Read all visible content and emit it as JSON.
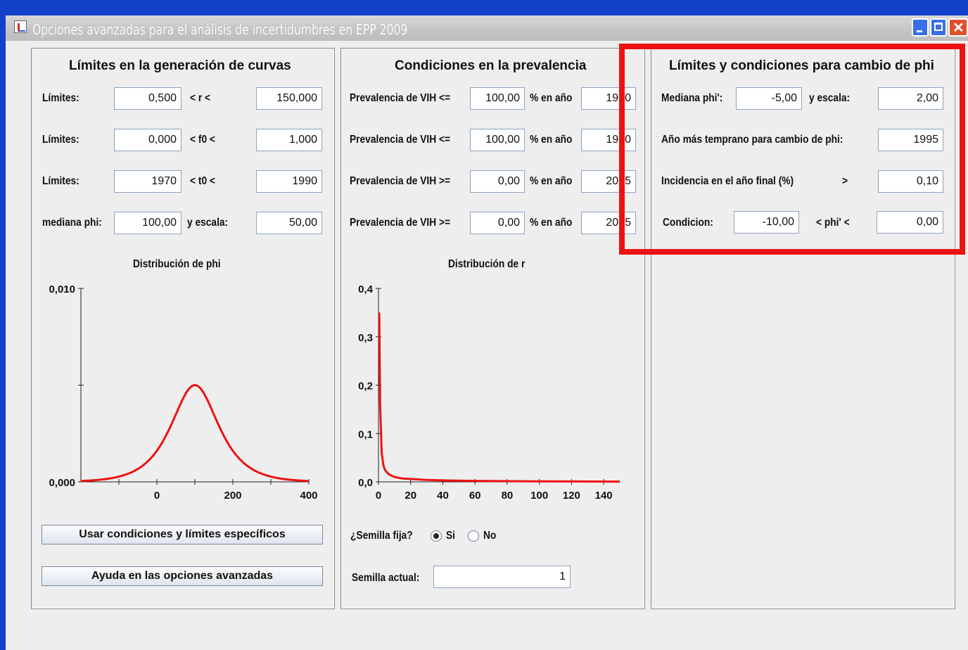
{
  "window": {
    "title": "Opciones avanzadas para el análisis de incertidumbres en EPP 2009"
  },
  "left": {
    "title": "Límites en la generación de curvas",
    "rows": [
      {
        "label": "Límites:",
        "min": "0,500",
        "op": "< r <",
        "max": "150,000"
      },
      {
        "label": "Límites:",
        "min": "0,000",
        "op": "< f0 <",
        "max": "1,000"
      },
      {
        "label": "Límites:",
        "min": "1970",
        "op": "< t0 <",
        "max": "1990"
      },
      {
        "label": "mediana phi:",
        "min": "100,00",
        "op": "y escala:",
        "max": "50,00"
      }
    ],
    "chart_title": "Distribución de phi",
    "use_button": "Usar condiciones y límites específicos",
    "help_button": "Ayuda en las opciones avanzadas"
  },
  "middle": {
    "title": "Condiciones en la prevalencia",
    "rows": [
      {
        "label": "Prevalencia de VIH <=",
        "value": "100,00",
        "unit": "% en año",
        "year": "1970"
      },
      {
        "label": "Prevalencia de VIH <=",
        "value": "100,00",
        "unit": "% en año",
        "year": "1970"
      },
      {
        "label": "Prevalencia de VIH >=",
        "value": "0,00",
        "unit": "% en año",
        "year": "2015"
      },
      {
        "label": "Prevalencia de VIH >=",
        "value": "0,00",
        "unit": "% en año",
        "year": "2015"
      }
    ],
    "chart_title": "Distribución de r",
    "seed_question": "¿Semilla fija?",
    "seed_yes": "Si",
    "seed_no": "No",
    "seed_label": "Semilla actual:",
    "seed_value": "1"
  },
  "right": {
    "title": "Límites y condiciones para cambio de phi",
    "median_label": "Mediana phi':",
    "median_value": "-5,00",
    "scale_label": "y escala:",
    "scale_value": "2,00",
    "earliest_label": "Año más temprano para cambio de phi:",
    "earliest_value": "1995",
    "incidence_label": "Incidencia en el año final (%)",
    "incidence_op": ">",
    "incidence_value": "0,10",
    "cond_label": "Condicion:",
    "cond_min": "-10,00",
    "cond_op": "< phi' <",
    "cond_max": "0,00"
  },
  "colors": {
    "curve": "#ee1111",
    "highlight": "#ee1111",
    "frame": "#1340c8"
  },
  "chart_data": [
    {
      "type": "line",
      "title": "Distribución de phi",
      "xlabel": "",
      "ylabel": "",
      "xlim": [
        -200,
        400
      ],
      "ylim": [
        0,
        0.01
      ],
      "x_ticks": [
        "0",
        "200",
        "400"
      ],
      "y_ticks": [
        "0,000",
        "0,010"
      ],
      "series": [
        {
          "median": 100,
          "scale": 50,
          "x": [
            -200,
            -150,
            -100,
            -50,
            0,
            25,
            50,
            75,
            100,
            125,
            150,
            175,
            200,
            250,
            300,
            350,
            400
          ],
          "y": [
            0.0001,
            0.0002,
            0.0004,
            0.0009,
            0.0021,
            0.003,
            0.004,
            0.0047,
            0.005,
            0.0047,
            0.004,
            0.003,
            0.0021,
            0.0009,
            0.0004,
            0.0002,
            0.0001
          ]
        }
      ]
    },
    {
      "type": "line",
      "title": "Distribución de r",
      "xlabel": "",
      "ylabel": "",
      "xlim": [
        0,
        150
      ],
      "ylim": [
        0,
        0.4
      ],
      "x_ticks": [
        "0",
        "20",
        "40",
        "60",
        "80",
        "100",
        "120",
        "140"
      ],
      "y_ticks": [
        "0,0",
        "0,1",
        "0,2",
        "0,3",
        "0,4"
      ],
      "series": [
        {
          "x": [
            0.5,
            1,
            2,
            3,
            4,
            6,
            8,
            10,
            15,
            20,
            30,
            40,
            60,
            80,
            100,
            150
          ],
          "y": [
            0.35,
            0.16,
            0.06,
            0.035,
            0.025,
            0.017,
            0.013,
            0.01,
            0.007,
            0.006,
            0.004,
            0.003,
            0.002,
            0.0015,
            0.001,
            0.0006
          ]
        }
      ]
    }
  ]
}
